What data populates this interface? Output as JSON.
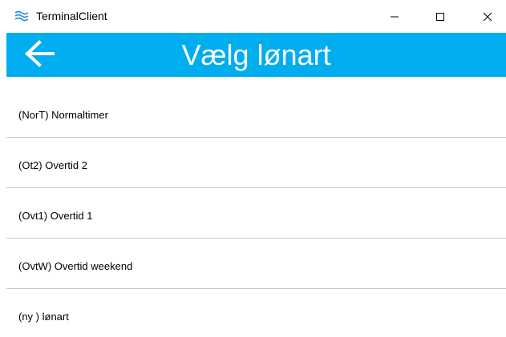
{
  "window": {
    "title": "TerminalClient",
    "controls": {
      "minimize": "minimize",
      "maximize": "maximize",
      "close": "close"
    }
  },
  "header": {
    "title": "Vælg lønart",
    "back_icon": "arrow-left-icon",
    "color": "#00aeef"
  },
  "list": {
    "items": [
      {
        "label": "(NorT) Normaltimer"
      },
      {
        "label": "(Ot2) Overtid 2"
      },
      {
        "label": "(Ovt1) Overtid 1"
      },
      {
        "label": "(OvtW) Overtid weekend"
      },
      {
        "label": "(ny ) lønart"
      }
    ]
  }
}
